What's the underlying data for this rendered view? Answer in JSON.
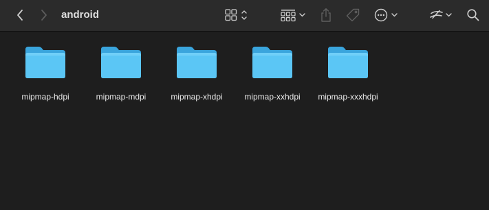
{
  "window": {
    "title": "android"
  },
  "toolbar": {
    "back_icon": "chevron-left-icon",
    "forward_icon": "chevron-right-icon",
    "view_icon": "grid-view-icon",
    "group_icon": "group-by-icon",
    "share_icon": "share-icon",
    "tag_icon": "tag-icon",
    "action_icon": "ellipsis-circle-icon",
    "sync_icon": "sync-icon",
    "search_icon": "search-icon"
  },
  "files": [
    {
      "name": "mipmap-hdpi",
      "icon": "folder-icon"
    },
    {
      "name": "mipmap-mdpi",
      "icon": "folder-icon"
    },
    {
      "name": "mipmap-xhdpi",
      "icon": "folder-icon"
    },
    {
      "name": "mipmap-xxhdpi",
      "icon": "folder-icon"
    },
    {
      "name": "mipmap-xxxhdpi",
      "icon": "folder-icon"
    }
  ],
  "colors": {
    "folder_back": "#3aa5dd",
    "folder_front": "#5bc6f5",
    "background": "#1e1e1e",
    "toolbar": "#2b2b2b"
  }
}
